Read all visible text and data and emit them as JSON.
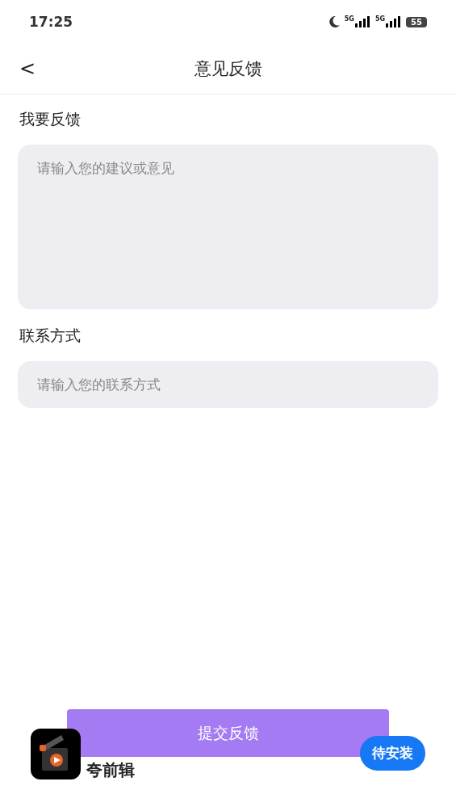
{
  "status_bar": {
    "time": "17:25",
    "networks": [
      "5G",
      "5G"
    ],
    "battery": "55"
  },
  "header": {
    "back": "<",
    "title": "意见反馈"
  },
  "form": [
    {
      "label": "我要反馈",
      "kind": "textarea",
      "placeholder": "请输入您的建议或意见"
    },
    {
      "label": "联系方式",
      "kind": "input",
      "placeholder": "请输入您的联系方式"
    }
  ],
  "submit_button": "提交反馈",
  "install_banner": {
    "app_name": "夸前辑",
    "button": "待安装"
  }
}
